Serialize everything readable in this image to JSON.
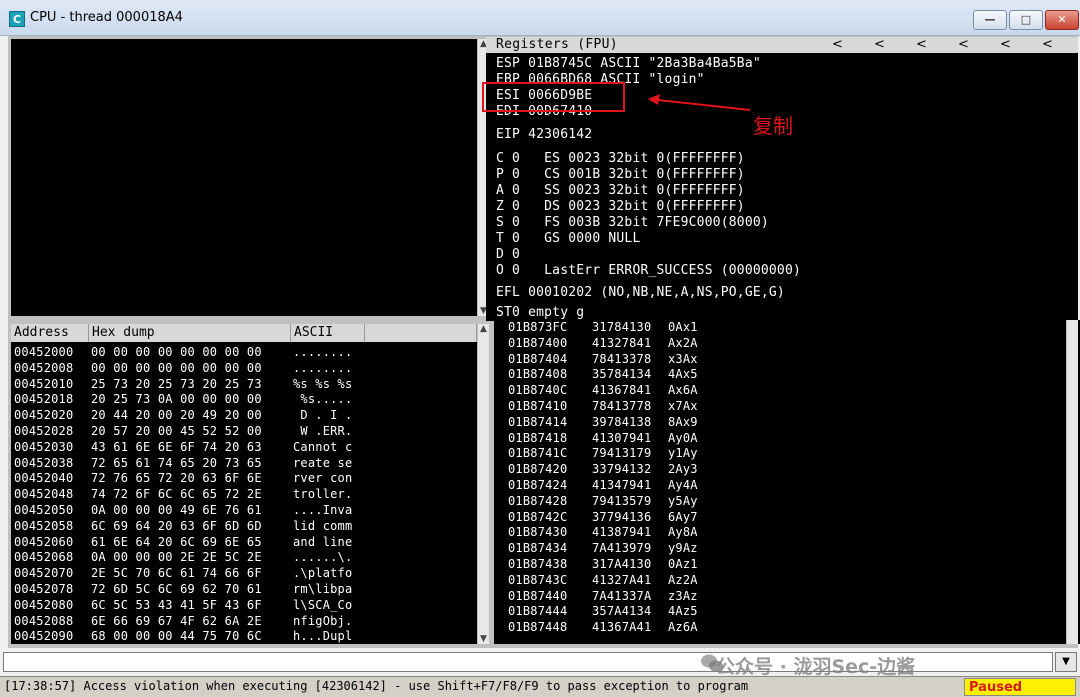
{
  "window": {
    "title": "CPU - thread 000018A4",
    "app_icon_letter": "C",
    "minimize": "—",
    "maximize": "□",
    "close": "✕"
  },
  "registers": {
    "title": "Registers (FPU)",
    "lines": [
      "ESP 01B8745C ASCII \"2Ba3Ba4Ba5Ba\"",
      "EBP 0066BD68 ASCII \"login\"",
      "ESI 0066D9BE",
      "EDI 00D67410",
      "EIP 42306142",
      "C 0   ES 0023 32bit 0(FFFFFFFF)",
      "P 0   CS 001B 32bit 0(FFFFFFFF)",
      "A 0   SS 0023 32bit 0(FFFFFFFF)",
      "Z 0   DS 0023 32bit 0(FFFFFFFF)",
      "S 0   FS 003B 32bit 7FE9C000(8000)",
      "T 0   GS 0000 NULL",
      "D 0",
      "O 0   LastErr ERROR_SUCCESS (00000000)",
      "EFL 00010202 (NO,NB,NE,A,NS,PO,GE,G)",
      "ST0 empty g"
    ]
  },
  "annotation": {
    "text": "复制",
    "color": "#e0141b"
  },
  "dump": {
    "headers": [
      "Address",
      "Hex dump",
      "ASCII"
    ],
    "rows": [
      [
        "00452000",
        "00 00 00 00 00 00 00 00",
        "........"
      ],
      [
        "00452008",
        "00 00 00 00 00 00 00 00",
        "........"
      ],
      [
        "00452010",
        "25 73 20 25 73 20 25 73",
        "%s %s %s"
      ],
      [
        "00452018",
        "20 25 73 0A 00 00 00 00",
        " %s....."
      ],
      [
        "00452020",
        "20 44 20 00 20 49 20 00",
        " D . I ."
      ],
      [
        "00452028",
        "20 57 20 00 45 52 52 00",
        " W .ERR."
      ],
      [
        "00452030",
        "43 61 6E 6E 6F 74 20 63",
        "Cannot c"
      ],
      [
        "00452038",
        "72 65 61 74 65 20 73 65",
        "reate se"
      ],
      [
        "00452040",
        "72 76 65 72 20 63 6F 6E",
        "rver con"
      ],
      [
        "00452048",
        "74 72 6F 6C 6C 65 72 2E",
        "troller."
      ],
      [
        "00452050",
        "0A 00 00 00 49 6E 76 61",
        "....Inva"
      ],
      [
        "00452058",
        "6C 69 64 20 63 6F 6D 6D",
        "lid comm"
      ],
      [
        "00452060",
        "61 6E 64 20 6C 69 6E 65",
        "and line"
      ],
      [
        "00452068",
        "0A 00 00 00 2E 2E 5C 2E",
        "......\\."
      ],
      [
        "00452070",
        "2E 5C 70 6C 61 74 66 6F",
        ".\\platfo"
      ],
      [
        "00452078",
        "72 6D 5C 6C 69 62 70 61",
        "rm\\libpa"
      ],
      [
        "00452080",
        "6C 5C 53 43 41 5F 43 6F",
        "l\\SCA_Co"
      ],
      [
        "00452088",
        "6E 66 69 67 4F 62 6A 2E",
        "nfigObj."
      ],
      [
        "00452090",
        "68 00 00 00 44 75 70 6C",
        "h...Dupl"
      ]
    ]
  },
  "stack": {
    "rows": [
      [
        "01B873FC",
        "31784130",
        "0Ax1"
      ],
      [
        "01B87400",
        "41327841",
        "Ax2A"
      ],
      [
        "01B87404",
        "78413378",
        "x3Ax"
      ],
      [
        "01B87408",
        "35784134",
        "4Ax5"
      ],
      [
        "01B8740C",
        "41367841",
        "Ax6A"
      ],
      [
        "01B87410",
        "78413778",
        "x7Ax"
      ],
      [
        "01B87414",
        "39784138",
        "8Ax9"
      ],
      [
        "01B87418",
        "41307941",
        "Ay0A"
      ],
      [
        "01B8741C",
        "79413179",
        "y1Ay"
      ],
      [
        "01B87420",
        "33794132",
        "2Ay3"
      ],
      [
        "01B87424",
        "41347941",
        "Ay4A"
      ],
      [
        "01B87428",
        "79413579",
        "y5Ay"
      ],
      [
        "01B8742C",
        "37794136",
        "6Ay7"
      ],
      [
        "01B87430",
        "41387941",
        "Ay8A"
      ],
      [
        "01B87434",
        "7A413979",
        "y9Az"
      ],
      [
        "01B87438",
        "317A4130",
        "0Az1"
      ],
      [
        "01B8743C",
        "41327A41",
        "Az2A"
      ],
      [
        "01B87440",
        "7A41337A",
        "z3Az"
      ],
      [
        "01B87444",
        "357A4134",
        "4Az5"
      ],
      [
        "01B87448",
        "41367A41",
        "Az6A"
      ]
    ]
  },
  "watermark": "公众号 · 泷羽Sec-边酱",
  "status": {
    "message": "[17:38:57] Access violation when executing [42306142] - use Shift+F7/F8/F9 to pass exception to program",
    "state": "Paused"
  }
}
